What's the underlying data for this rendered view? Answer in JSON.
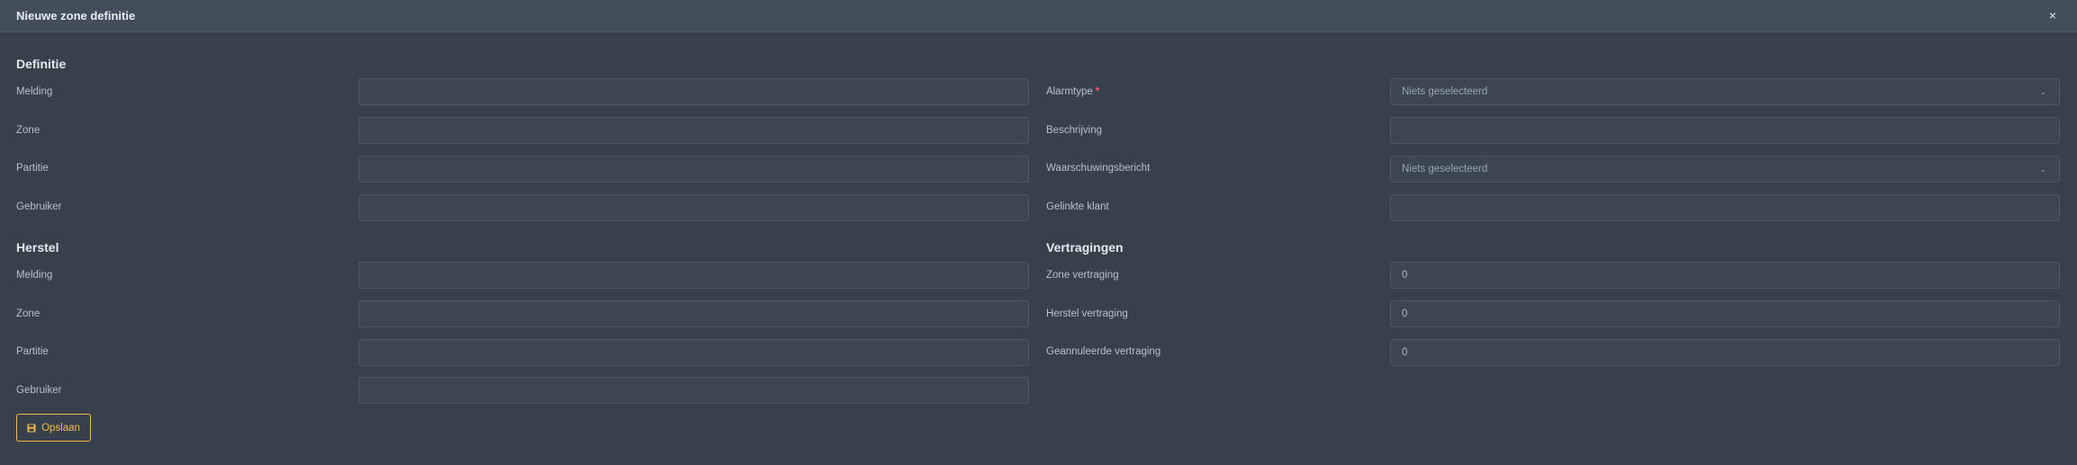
{
  "modal": {
    "title": "Nieuwe zone definitie",
    "close_icon": "×"
  },
  "definitie": {
    "title": "Definitie",
    "fields": [
      {
        "label": "Melding",
        "value": ""
      },
      {
        "label": "Zone",
        "value": ""
      },
      {
        "label": "Partitie",
        "value": ""
      },
      {
        "label": "Gebruiker",
        "value": ""
      }
    ]
  },
  "right_top": {
    "alarmtype_label": "Alarmtype",
    "required_mark": "*",
    "alarmtype_value": "Niets geselecteerd",
    "beschrijving_label": "Beschrijving",
    "beschrijving_value": "",
    "waarschuwing_label": "Waarschuwingsbericht",
    "waarschuwing_value": "Niets geselecteerd",
    "klant_label": "Gelinkte klant",
    "klant_value": ""
  },
  "herstel": {
    "title": "Herstel",
    "fields": [
      {
        "label": "Melding",
        "value": ""
      },
      {
        "label": "Zone",
        "value": ""
      },
      {
        "label": "Partitie",
        "value": ""
      },
      {
        "label": "Gebruiker",
        "value": ""
      }
    ]
  },
  "vertragingen": {
    "title": "Vertragingen",
    "fields": [
      {
        "label": "Zone vertraging",
        "value": "0"
      },
      {
        "label": "Herstel vertraging",
        "value": "0"
      },
      {
        "label": "Geannuleerde vertraging",
        "value": "0"
      }
    ]
  },
  "actions": {
    "save_label": "Opslaan",
    "save_icon": "save-icon"
  },
  "colors": {
    "accent": "#f7b84b",
    "required": "#f1556c",
    "header_bg": "#424e5a",
    "body_bg": "#37414b"
  }
}
